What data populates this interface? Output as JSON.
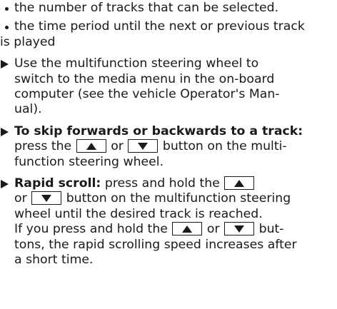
{
  "bullets": [
    {
      "lines": [
        "the number of tracks that can be selected."
      ]
    },
    {
      "lines": [
        "the time period until the next or previous track",
        "is played"
      ]
    }
  ],
  "steps": {
    "s1": {
      "lines": [
        "Use the multifunction steering wheel to",
        "switch to the media menu in the on-board",
        "computer (see the vehicle Operator's Man-",
        "ual)."
      ]
    },
    "s2": {
      "bold_label": "To skip forwards or backwards to a track:",
      "l2_pre": "press the",
      "l2_mid": "or",
      "l2_post": "button on the multi-",
      "l3": "function steering wheel."
    },
    "s3": {
      "bold_label": "Rapid scroll:",
      "l1_text": "press and hold the",
      "l2_pre": "or",
      "l2_post": "button on the multifunction steering",
      "l3": "wheel until the desired track is reached.",
      "l4_pre": "If you press and hold the",
      "l4_mid": "or",
      "l4_post": "but-",
      "l5": "tons, the rapid scrolling speed increases after",
      "l6": "a short time."
    }
  },
  "icons": {
    "up": "arrow-up-icon",
    "down": "arrow-down-icon",
    "bullet": "bullet-dot-icon",
    "step": "step-triangle-icon"
  }
}
